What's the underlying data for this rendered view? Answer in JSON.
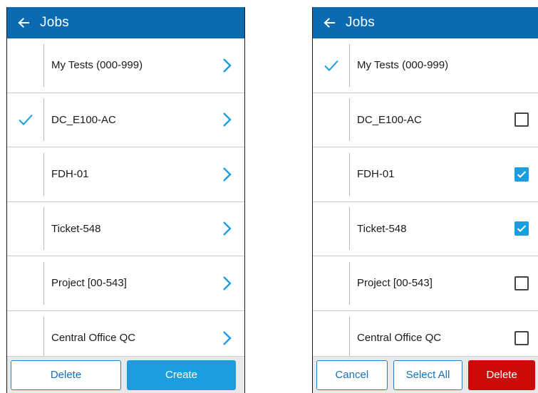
{
  "colors": {
    "header_bg": "#0a6bb3",
    "accent": "#1a9ee0",
    "danger": "#cc0a0a"
  },
  "left_screen": {
    "header": {
      "title": "Jobs",
      "back_icon": "arrow-left-icon"
    },
    "items": [
      {
        "label": "My Tests (000-999)",
        "selected": false
      },
      {
        "label": "DC_E100-AC",
        "selected": true
      },
      {
        "label": "FDH-01",
        "selected": false
      },
      {
        "label": "Ticket-548",
        "selected": false
      },
      {
        "label": "Project [00-543]",
        "selected": false
      },
      {
        "label": "Central Office QC",
        "selected": false
      }
    ],
    "footer": {
      "delete_label": "Delete",
      "create_label": "Create"
    }
  },
  "right_screen": {
    "header": {
      "title": "Jobs",
      "back_icon": "arrow-left-icon"
    },
    "items": [
      {
        "label": "My Tests (000-999)",
        "active": true,
        "checkbox": null
      },
      {
        "label": "DC_E100-AC",
        "active": false,
        "checkbox": false
      },
      {
        "label": "FDH-01",
        "active": false,
        "checkbox": true
      },
      {
        "label": "Ticket-548",
        "active": false,
        "checkbox": true
      },
      {
        "label": "Project [00-543]",
        "active": false,
        "checkbox": false
      },
      {
        "label": "Central Office QC",
        "active": false,
        "checkbox": false
      }
    ],
    "footer": {
      "cancel_label": "Cancel",
      "select_all_label": "Select All",
      "delete_label": "Delete"
    }
  }
}
